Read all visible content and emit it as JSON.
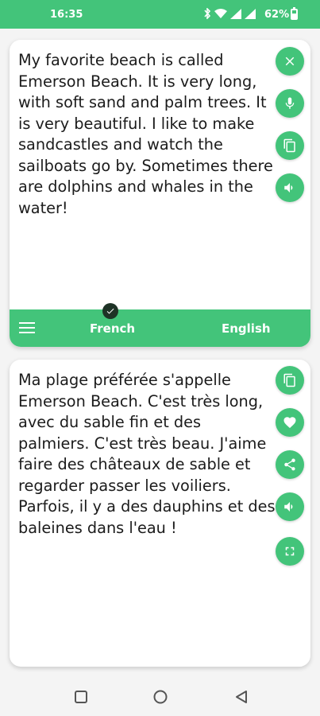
{
  "status_bar": {
    "time": "16:35",
    "battery": "62%",
    "icons": [
      "bluetooth-icon",
      "wifi-icon",
      "signal-icon",
      "signal-icon",
      "battery-icon"
    ]
  },
  "source": {
    "text": "My favorite beach is called Emerson Beach. It is very long, with soft sand and palm trees. It is very beautiful. I like to make sandcastles and watch the sailboats go by. Sometimes there are dolphins and whales in the water!",
    "actions": [
      "close-icon",
      "mic-icon",
      "copy-icon",
      "speaker-icon"
    ]
  },
  "language_bar": {
    "source_language": "French",
    "target_language": "English",
    "menu_icon": "menu-icon",
    "selected_icon": "check-icon"
  },
  "translation": {
    "text": "Ma plage préférée s'appelle Emerson Beach. C'est très long, avec du sable fin et des palmiers. C'est très beau. J'aime faire des châteaux de sable et regarder passer les voiliers. Parfois, il y a des dauphins et des baleines dans l'eau !",
    "actions": [
      "copy-icon",
      "heart-icon",
      "share-icon",
      "speaker-icon",
      "fullscreen-icon"
    ]
  },
  "nav_bar": {
    "buttons": [
      "recents-icon",
      "home-icon",
      "back-icon"
    ]
  },
  "colors": {
    "accent": "#43c47a",
    "card": "#ffffff",
    "background": "#f4f4f4",
    "text": "#1b1b1b"
  }
}
